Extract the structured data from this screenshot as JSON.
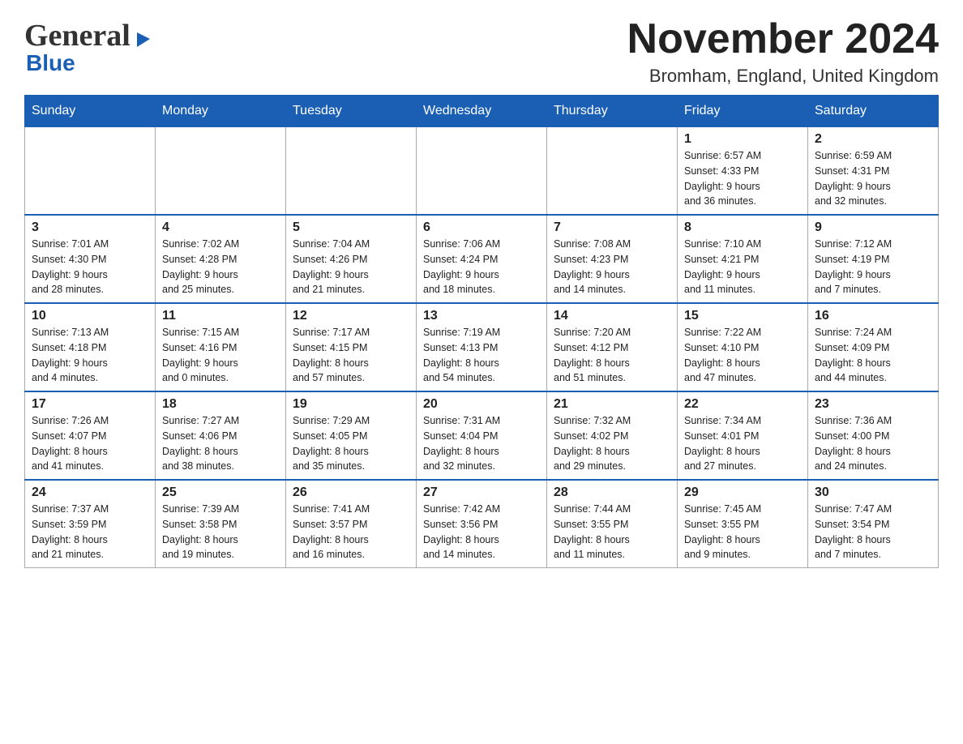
{
  "header": {
    "month_title": "November 2024",
    "location": "Bromham, England, United Kingdom",
    "logo_line1": "General",
    "logo_line2": "Blue"
  },
  "days_of_week": [
    "Sunday",
    "Monday",
    "Tuesday",
    "Wednesday",
    "Thursday",
    "Friday",
    "Saturday"
  ],
  "weeks": [
    {
      "days": [
        {
          "date": "",
          "info": ""
        },
        {
          "date": "",
          "info": ""
        },
        {
          "date": "",
          "info": ""
        },
        {
          "date": "",
          "info": ""
        },
        {
          "date": "",
          "info": ""
        },
        {
          "date": "1",
          "info": "Sunrise: 6:57 AM\nSunset: 4:33 PM\nDaylight: 9 hours\nand 36 minutes."
        },
        {
          "date": "2",
          "info": "Sunrise: 6:59 AM\nSunset: 4:31 PM\nDaylight: 9 hours\nand 32 minutes."
        }
      ]
    },
    {
      "days": [
        {
          "date": "3",
          "info": "Sunrise: 7:01 AM\nSunset: 4:30 PM\nDaylight: 9 hours\nand 28 minutes."
        },
        {
          "date": "4",
          "info": "Sunrise: 7:02 AM\nSunset: 4:28 PM\nDaylight: 9 hours\nand 25 minutes."
        },
        {
          "date": "5",
          "info": "Sunrise: 7:04 AM\nSunset: 4:26 PM\nDaylight: 9 hours\nand 21 minutes."
        },
        {
          "date": "6",
          "info": "Sunrise: 7:06 AM\nSunset: 4:24 PM\nDaylight: 9 hours\nand 18 minutes."
        },
        {
          "date": "7",
          "info": "Sunrise: 7:08 AM\nSunset: 4:23 PM\nDaylight: 9 hours\nand 14 minutes."
        },
        {
          "date": "8",
          "info": "Sunrise: 7:10 AM\nSunset: 4:21 PM\nDaylight: 9 hours\nand 11 minutes."
        },
        {
          "date": "9",
          "info": "Sunrise: 7:12 AM\nSunset: 4:19 PM\nDaylight: 9 hours\nand 7 minutes."
        }
      ]
    },
    {
      "days": [
        {
          "date": "10",
          "info": "Sunrise: 7:13 AM\nSunset: 4:18 PM\nDaylight: 9 hours\nand 4 minutes."
        },
        {
          "date": "11",
          "info": "Sunrise: 7:15 AM\nSunset: 4:16 PM\nDaylight: 9 hours\nand 0 minutes."
        },
        {
          "date": "12",
          "info": "Sunrise: 7:17 AM\nSunset: 4:15 PM\nDaylight: 8 hours\nand 57 minutes."
        },
        {
          "date": "13",
          "info": "Sunrise: 7:19 AM\nSunset: 4:13 PM\nDaylight: 8 hours\nand 54 minutes."
        },
        {
          "date": "14",
          "info": "Sunrise: 7:20 AM\nSunset: 4:12 PM\nDaylight: 8 hours\nand 51 minutes."
        },
        {
          "date": "15",
          "info": "Sunrise: 7:22 AM\nSunset: 4:10 PM\nDaylight: 8 hours\nand 47 minutes."
        },
        {
          "date": "16",
          "info": "Sunrise: 7:24 AM\nSunset: 4:09 PM\nDaylight: 8 hours\nand 44 minutes."
        }
      ]
    },
    {
      "days": [
        {
          "date": "17",
          "info": "Sunrise: 7:26 AM\nSunset: 4:07 PM\nDaylight: 8 hours\nand 41 minutes."
        },
        {
          "date": "18",
          "info": "Sunrise: 7:27 AM\nSunset: 4:06 PM\nDaylight: 8 hours\nand 38 minutes."
        },
        {
          "date": "19",
          "info": "Sunrise: 7:29 AM\nSunset: 4:05 PM\nDaylight: 8 hours\nand 35 minutes."
        },
        {
          "date": "20",
          "info": "Sunrise: 7:31 AM\nSunset: 4:04 PM\nDaylight: 8 hours\nand 32 minutes."
        },
        {
          "date": "21",
          "info": "Sunrise: 7:32 AM\nSunset: 4:02 PM\nDaylight: 8 hours\nand 29 minutes."
        },
        {
          "date": "22",
          "info": "Sunrise: 7:34 AM\nSunset: 4:01 PM\nDaylight: 8 hours\nand 27 minutes."
        },
        {
          "date": "23",
          "info": "Sunrise: 7:36 AM\nSunset: 4:00 PM\nDaylight: 8 hours\nand 24 minutes."
        }
      ]
    },
    {
      "days": [
        {
          "date": "24",
          "info": "Sunrise: 7:37 AM\nSunset: 3:59 PM\nDaylight: 8 hours\nand 21 minutes."
        },
        {
          "date": "25",
          "info": "Sunrise: 7:39 AM\nSunset: 3:58 PM\nDaylight: 8 hours\nand 19 minutes."
        },
        {
          "date": "26",
          "info": "Sunrise: 7:41 AM\nSunset: 3:57 PM\nDaylight: 8 hours\nand 16 minutes."
        },
        {
          "date": "27",
          "info": "Sunrise: 7:42 AM\nSunset: 3:56 PM\nDaylight: 8 hours\nand 14 minutes."
        },
        {
          "date": "28",
          "info": "Sunrise: 7:44 AM\nSunset: 3:55 PM\nDaylight: 8 hours\nand 11 minutes."
        },
        {
          "date": "29",
          "info": "Sunrise: 7:45 AM\nSunset: 3:55 PM\nDaylight: 8 hours\nand 9 minutes."
        },
        {
          "date": "30",
          "info": "Sunrise: 7:47 AM\nSunset: 3:54 PM\nDaylight: 8 hours\nand 7 minutes."
        }
      ]
    }
  ]
}
